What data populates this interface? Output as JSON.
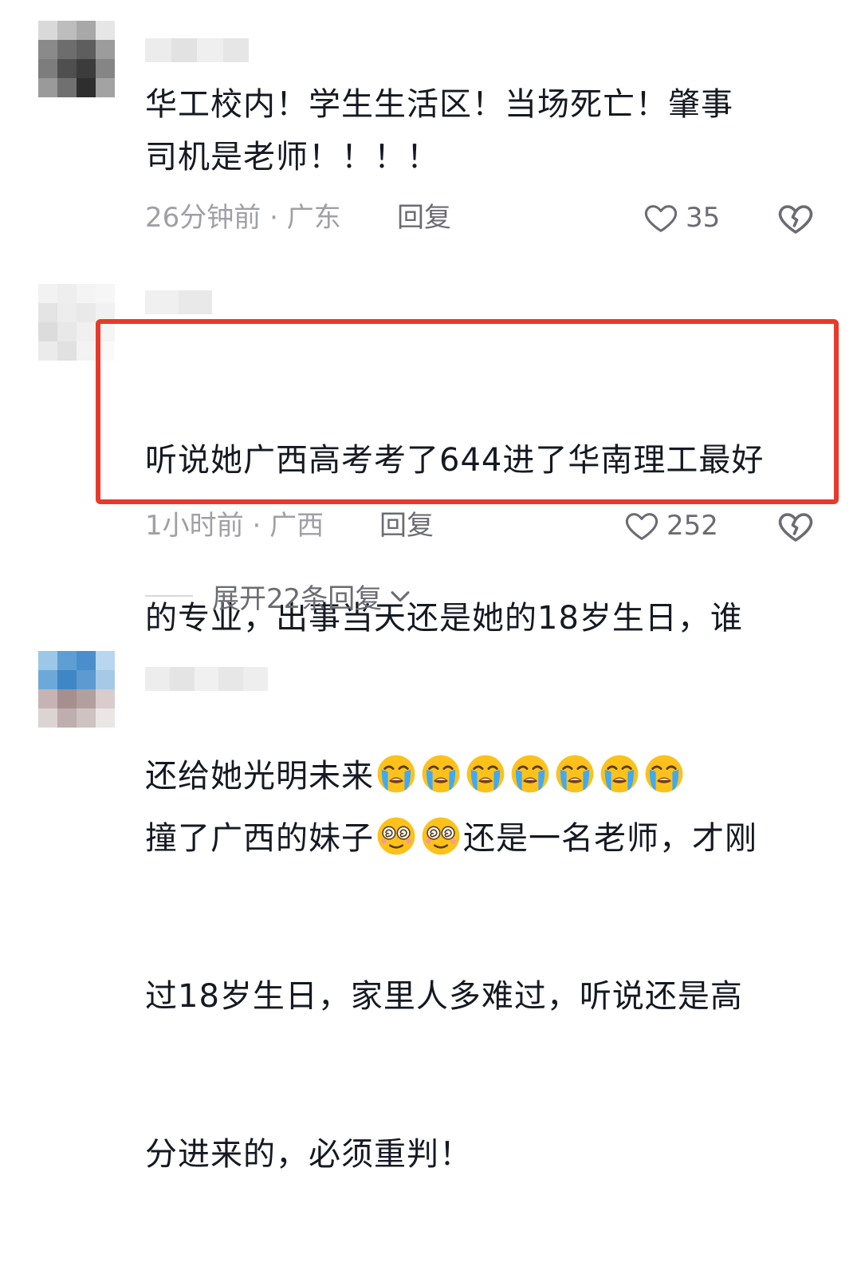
{
  "comments": [
    {
      "text": "华工校内！学生生活区！当场死亡！肇事\n司机是老师！！！！",
      "time": "26分钟前",
      "location": "· 广东",
      "reply_label": "回复",
      "likes": "35",
      "like_icon": "heart-outline-icon",
      "dislike_icon": "broken-heart-icon"
    },
    {
      "text_line1": "听说她广西高考考了644进了华南理工最好",
      "text_line2": "的专业，出事当天还是她的18岁生日，谁",
      "text_line3": "还给她光明未来",
      "emoji": "loudly-crying-face",
      "emoji_count": 7,
      "time": "1小时前",
      "location": "· 广西",
      "reply_label": "回复",
      "likes": "252",
      "highlight_color": "#e8392b",
      "expand_label": "展开22条回复"
    },
    {
      "text_line1_a": "撞了广西的妹子",
      "text_line1_b": "还是一名老师，才刚",
      "text_line2": "过18岁生日，家里人多难过，听说还是高",
      "text_line3": "分进来的，必须重判！",
      "emoji": "dizzy-face",
      "emoji_count": 2
    }
  ],
  "colors": {
    "text": "#161823",
    "meta": "#9fa0a7",
    "secondary": "#6b6c73",
    "highlight": "#e8392b"
  }
}
